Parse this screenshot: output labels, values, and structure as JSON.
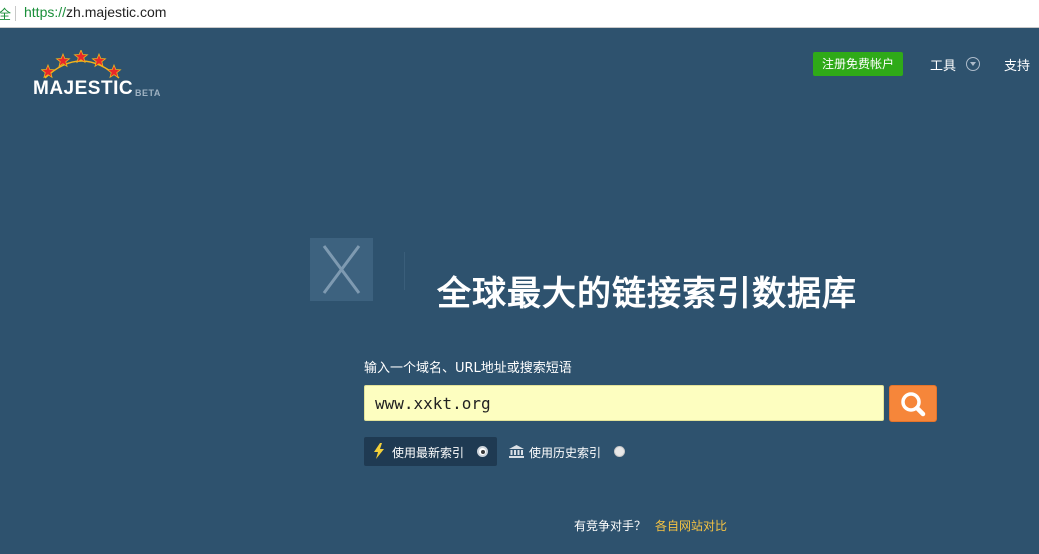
{
  "browser": {
    "security_label": "全",
    "url_scheme": "https://",
    "url_host": "zh.majestic.com"
  },
  "logo": {
    "wordmark": "MAJESTIC",
    "beta": "BETA",
    "star_color": "#e8272a"
  },
  "nav": {
    "signup_label": "注册免费帐户",
    "tools_label": "工具",
    "support_label": "支持"
  },
  "hero": {
    "headline": "全球最大的链接索引数据库"
  },
  "search": {
    "label": "输入一个域名、URL地址或搜索短语",
    "value": "www.xxkt.org",
    "button_icon": "search-icon"
  },
  "index_options": [
    {
      "label": "使用最新索引",
      "icon": "lightning-icon",
      "selected": true
    },
    {
      "label": "使用历史索引",
      "icon": "bank-icon",
      "selected": false
    }
  ],
  "footer": {
    "question": "有竞争对手？",
    "link": "各自网站对比"
  },
  "colors": {
    "background": "#2e526e",
    "signup_green": "#2faa18",
    "search_orange": "#f6863a",
    "input_yellow": "#fdfec0",
    "link_gold": "#f5c343"
  }
}
